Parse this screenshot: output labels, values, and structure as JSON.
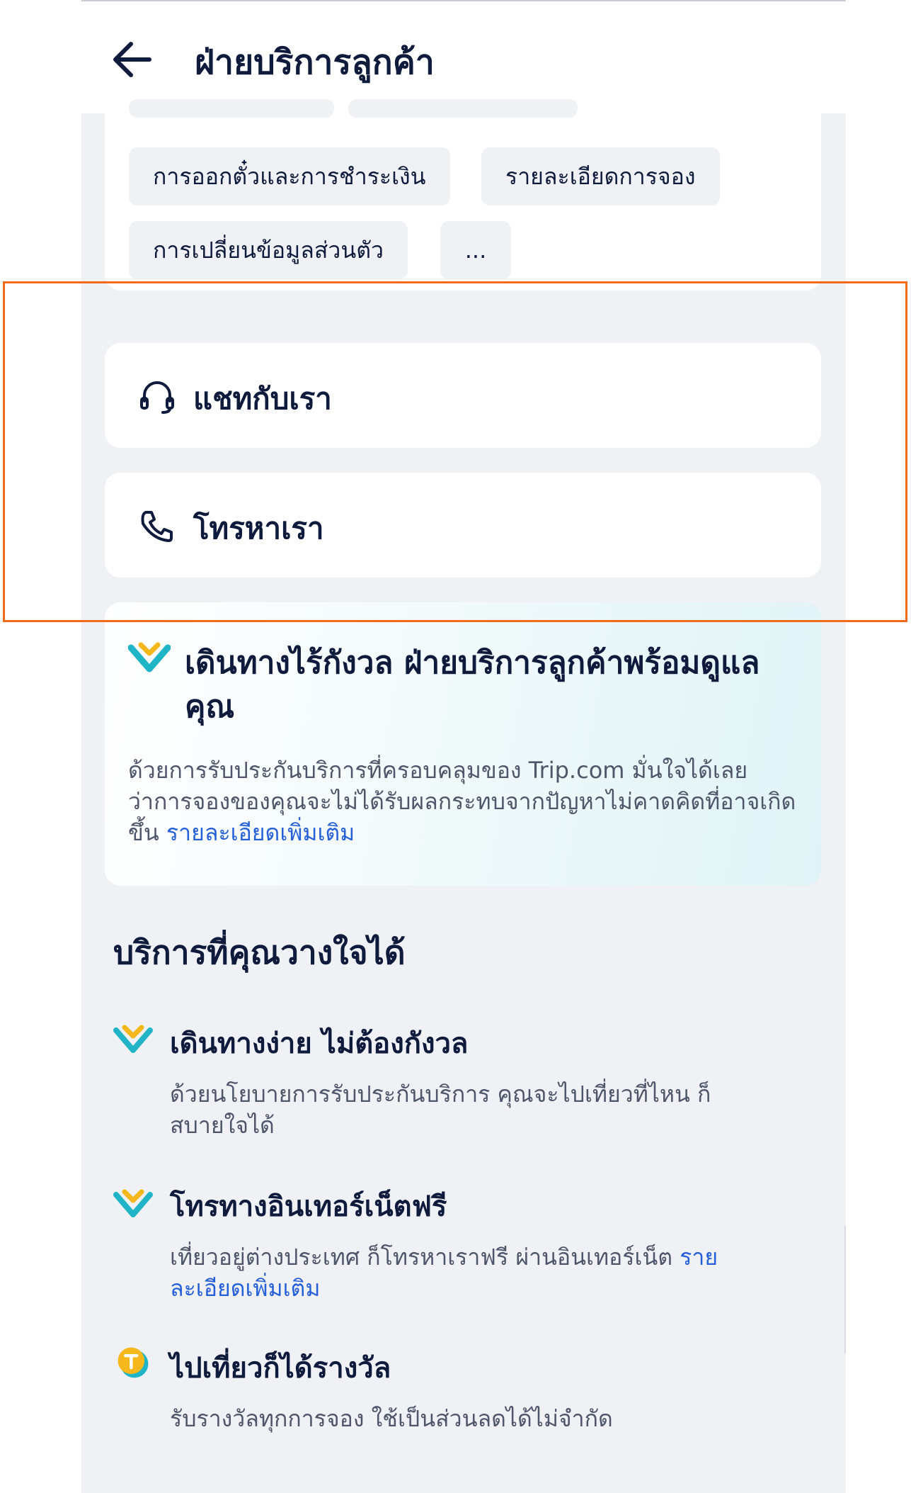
{
  "header": {
    "title": "ฝ่ายบริการลูกค้า",
    "back_icon": "arrow-left-icon"
  },
  "topics": {
    "chips": [
      "การออกตั๋วและการชำระเงิน",
      "รายละเอียดการจอง",
      "การเปลี่ยนข้อมูลส่วนตัว",
      "..."
    ]
  },
  "contact": {
    "chat_label": "แชทกับเรา",
    "chat_icon": "headset-icon",
    "call_label": "โทรหาเรา",
    "call_icon": "phone-icon"
  },
  "guarantee": {
    "icon": "heart-shield-icon",
    "title": "เดินทางไร้กังวล ฝ่ายบริการลูกค้าพร้อมดูแลคุณ",
    "description": "ด้วยการรับประกันบริการที่ครอบคลุมของ Trip.com มั่นใจได้เลยว่าการจองของคุณจะไม่ได้รับผลกระทบจากปัญหาไม่คาดคิดที่อาจเกิดขึ้น",
    "link": "รายละเอียดเพิ่มเติม"
  },
  "services": {
    "title": "บริการที่คุณวางใจได้",
    "items": [
      {
        "icon": "heart-shield-icon",
        "title": "เดินทางง่าย ไม่ต้องกังวล",
        "description": "ด้วยนโยบายการรับประกันบริการ คุณจะไปเที่ยวที่ไหน ก็สบายใจได้"
      },
      {
        "icon": "heart-shield-icon",
        "title": "โทรทางอินเทอร์เน็ตฟรี",
        "description": "เที่ยวอยู่ต่างประเทศ ก็โทรหาเราฟรี ผ่านอินเทอร์เน็ต",
        "link": "รายละเอียดเพิ่มเติม"
      },
      {
        "icon": "trip-coin-icon",
        "title": "ไปเที่ยวก็ได้รางวัล",
        "description": "รับรางวัลทุกการจอง ใช้เป็นส่วนลดได้ไม่จำกัด"
      }
    ]
  },
  "colors": {
    "text_primary": "#0f1b3d",
    "text_secondary": "#4f566b",
    "link": "#2560d9",
    "highlight": "#f26a1b",
    "teal": "#1fb5c6",
    "gold": "#f5b81c",
    "background": "#f0f1f5"
  }
}
